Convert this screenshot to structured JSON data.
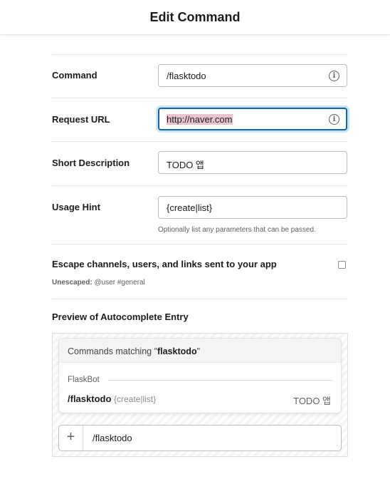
{
  "header": {
    "title": "Edit Command"
  },
  "form": {
    "command": {
      "label": "Command",
      "value": "/flasktodo",
      "info_icon": "info-icon"
    },
    "request_url": {
      "label": "Request URL",
      "value": "http://naver.com",
      "info_icon": "info-icon"
    },
    "short_description": {
      "label": "Short Description",
      "value": "TODO 앱"
    },
    "usage_hint": {
      "label": "Usage Hint",
      "value": "{create|list}",
      "helper": "Optionally list any parameters that can be passed."
    },
    "escape": {
      "label": "Escape channels, users, and links sent to your app",
      "checked": false,
      "sub_prefix": "Unescaped:",
      "sub_value": "@user #general"
    }
  },
  "preview": {
    "heading": "Preview of Autocomplete Entry",
    "matching_prefix": "Commands matching \"",
    "matching_term": "flasktodo",
    "matching_suffix": "\"",
    "group": "FlaskBot",
    "command": "/flasktodo",
    "hint": "{create|list}",
    "description": "TODO 앱",
    "composer_text": "/flasktodo",
    "composer_plus": "+"
  },
  "colors": {
    "focus_border": "#1264a3",
    "selection": "#e9c3cd"
  }
}
